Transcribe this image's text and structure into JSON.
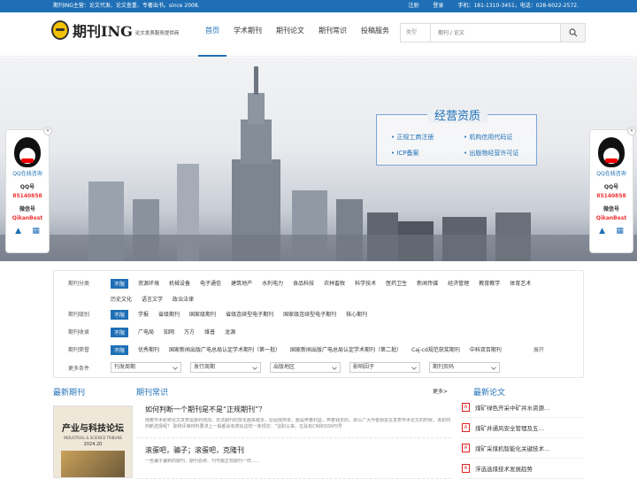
{
  "topbar": {
    "left": "期刊ING主营：论文代发、论文查重、专著出书。since 2008.",
    "register": "注册",
    "login": "登录",
    "contact": "手机：181-1310-3451，电话：028-6022-2572."
  },
  "header": {
    "logo_text": "期刊ING",
    "logo_sub": "论文发表服务提供商",
    "nav": [
      "首页",
      "学术期刊",
      "期刊论文",
      "期刊常识",
      "投稿服务"
    ],
    "search_type": "类型",
    "search_placeholder": "期刊 / 论文"
  },
  "banner": {
    "title": "经营资质",
    "items": [
      "正规工商注册",
      "机构信用代码证",
      "ICP备案",
      "出版物经营许可证"
    ]
  },
  "qq_widget": {
    "title": "QQ在线咨询",
    "qq_label": "QQ号",
    "qq_value": "85140858",
    "wechat_label": "微信号",
    "wechat_value": "QikanBest"
  },
  "filters": {
    "category": {
      "label": "期刊分类",
      "items": [
        "不限",
        "资源环境",
        "机械设备",
        "电子通信",
        "建筑地产",
        "水利电力",
        "食品科技",
        "农林畜牧",
        "科学技术",
        "医药卫生",
        "新闻传媒",
        "经济管理",
        "教育教学",
        "体育艺术",
        "历史文化",
        "语言文学",
        "政治法律"
      ]
    },
    "level": {
      "label": "期刊级别",
      "items": [
        "不限",
        "学报",
        "省级期刊",
        "国家级期刊",
        "省级连续型电子期刊",
        "国家级连续型电子期刊",
        "核心期刊"
      ]
    },
    "indexed": {
      "label": "期刊收录",
      "items": [
        "不限",
        "广电局",
        "知网",
        "万方",
        "维普",
        "龙源"
      ]
    },
    "honor": {
      "label": "期刊荣誉",
      "items": [
        "不限",
        "优秀期刊",
        "国家新闻出版广电总局认定学术期刊（第一批）",
        "国家新闻出版广电总局认定学术期刊（第二批）",
        "Caj-cd规范获奖期刊",
        "中科双百期刊"
      ],
      "more": "展开"
    },
    "more_conditions": {
      "label": "更多条件",
      "selects": [
        "刊发周期",
        "发行周期",
        "出版地区",
        "影响因子",
        "期刊页码"
      ]
    }
  },
  "sections": {
    "newest_journals": "最新期刊",
    "journal_knowledge": "期刊常识",
    "more": "更多>",
    "latest_papers": "最新论文"
  },
  "journal_cover": {
    "title": "产业与科技论坛",
    "english": "INDUSTRIAL & SCIENCE TRIBUNE",
    "year": "2024.20"
  },
  "articles": [
    {
      "title": "如何判断一个期刊是不是“正规期刊”？",
      "excerpt": "随着学术职称论文发表需要的增加，非法期刊的变化越来越多，原因很简单，都是奔着利益，奔着钱去的。那么广大作者朋友在发表学术论文的时候，该如何判断选择呢？ 职称评审材料要求上一般都会有类似这样一条规定：“征职以来，在具有CN和ISSN刊号"
    },
    {
      "title": "滚蛋吧，骗子；滚蛋吧，克隆刊",
      "excerpt": "一些骗子骗到的期刊，期刊名称、刊号都正规期刊一样……"
    }
  ],
  "latest_papers": [
    "煤矿绿色开采中矿井水资源…",
    "煤矿井通风安全管理及五…",
    "煤矿采煤机智能化关键技术…",
    "浮选选煤技术发展趋势"
  ]
}
